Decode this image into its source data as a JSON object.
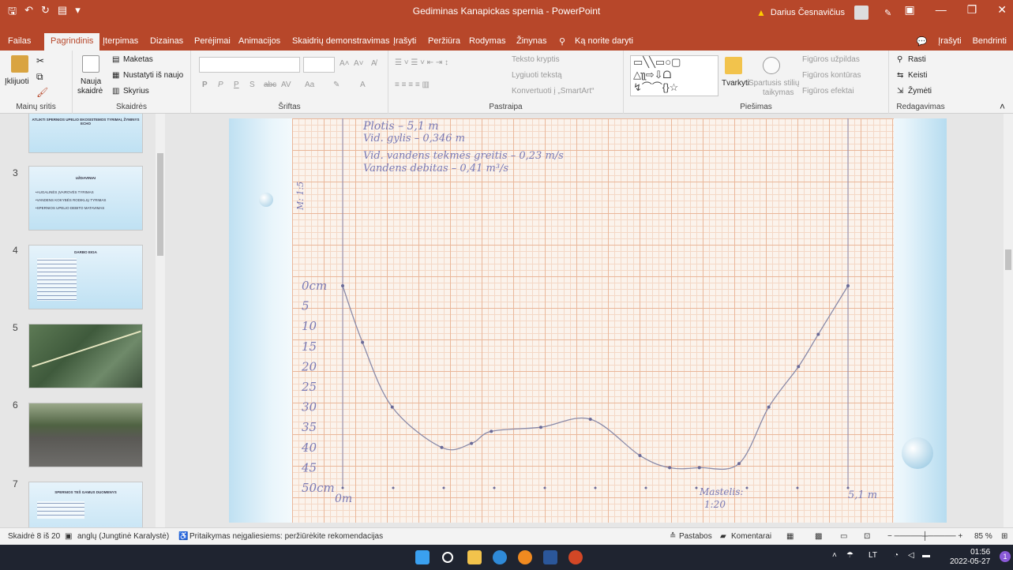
{
  "app": {
    "title": "Gediminas Kanapickas spernia  -  PowerPoint",
    "warning_icon": "warning-icon",
    "user_name": "Darius Česnavičius"
  },
  "tabs": [
    {
      "label": "Failas"
    },
    {
      "label": "Pagrindinis"
    },
    {
      "label": "Įterpimas"
    },
    {
      "label": "Dizainas"
    },
    {
      "label": "Perėjimai"
    },
    {
      "label": "Animacijos"
    },
    {
      "label": "Skaidrių demonstravimas"
    },
    {
      "label": "Įrašyti"
    },
    {
      "label": "Peržiūra"
    },
    {
      "label": "Rodymas"
    },
    {
      "label": "Žinynas"
    },
    {
      "label": "Ką norite daryti"
    }
  ],
  "tabs_right": {
    "record": "Įrašyti",
    "share": "Bendrinti"
  },
  "ribbon": {
    "clipboard": {
      "paste": "Įklijuoti",
      "group": "Mainų sritis"
    },
    "slides": {
      "new_slide_1": "Nauja",
      "new_slide_2": "skaidrė",
      "layout": "Maketas",
      "reset": "Nustatyti iš naujo",
      "section": "Skyrius",
      "group": "Skaidrės"
    },
    "font": {
      "group": "Šriftas",
      "bold": "P",
      "italic": "P",
      "underline": "P",
      "shadow": "S",
      "strike": "abc",
      "spacing": "AV",
      "case": "Aa",
      "color": "A"
    },
    "paragraph": {
      "text_direction": "Teksto kryptis",
      "align_text": "Lygiuoti tekstą",
      "smartart": "Konvertuoti į „SmartArt“",
      "group": "Pastraipa"
    },
    "drawing": {
      "arrange": "Tvarkyti",
      "quick_styles_1": "Spartusis stilių",
      "quick_styles_2": "taikymas",
      "fill": "Figūros užpildas",
      "outline": "Figūros kontūras",
      "effects": "Figūros efektai",
      "group": "Piešimas"
    },
    "editing": {
      "find": "Rasti",
      "replace": "Keisti",
      "select": "Žymėti",
      "group": "Redagavimas"
    }
  },
  "thumbnails": [
    {
      "num": "",
      "title": "ATLIKTI SPERNIOS UPELIO EKOSISTEMOS TYRIMAI, ŽYMINYS ECHO",
      "lines": []
    },
    {
      "num": "3",
      "title": "UŽDAVINIAI",
      "lines": [
        "•AUGALINĖS ĮVAIROVĖS TYRIMAS",
        "•VANDENS KOKYBĖS RODIKLIŲ TYRIMAS",
        "•SPERNIOS UPELIO DEBITO MATAVIMAS"
      ]
    },
    {
      "num": "4",
      "title": "DARBO EIGA",
      "lines": [
        "·",
        "·",
        "·",
        "·",
        "·",
        "·",
        "·",
        "·",
        "·",
        "·"
      ]
    },
    {
      "num": "5",
      "title": "",
      "lines": []
    },
    {
      "num": "6",
      "title": "",
      "lines": []
    },
    {
      "num": "7",
      "title": "SPERNIOS TEŠ GAMUS DUOMENYS",
      "lines": [
        "·",
        "·",
        "·",
        "·"
      ]
    }
  ],
  "slide": {
    "notes": [
      "Plotis – 5,1 m",
      "Vid. gylis – 0,346 m",
      "Vid. vandens tekmės greitis – 0,23 m/s",
      "Vandens debitas – 0,41 m³/s"
    ],
    "scale_vertical": "M: 1:5",
    "depth_labels": [
      "0cm",
      "5",
      "10",
      "15",
      "20",
      "25",
      "30",
      "35",
      "40",
      "45",
      "50cm"
    ],
    "bottom_left": "0m",
    "scale_bottom_1": "Mastelis:",
    "scale_bottom_2": "1:20",
    "bottom_right": "5,1 m"
  },
  "chart_data": {
    "type": "line",
    "xlabel": "",
    "ylabel": "",
    "x": [
      0.0,
      0.2,
      0.5,
      1.0,
      1.3,
      1.5,
      2.0,
      2.5,
      3.0,
      3.3,
      3.6,
      4.0,
      4.3,
      4.6,
      4.8,
      5.1
    ],
    "y": [
      0,
      14,
      30,
      40,
      39,
      36,
      35,
      33,
      42,
      45,
      45,
      44,
      30,
      20,
      12,
      0
    ],
    "ylim": [
      0,
      50
    ],
    "xlim": [
      0,
      5.1
    ],
    "y_inverted": true
  },
  "status": {
    "slide_count": "Skaidrė 8 iš 20",
    "language": "anglų (Jungtinė Karalystė)",
    "accessibility": "Pritaikymas neįgaliesiems: peržiūrėkite rekomendacijas",
    "notes": "Pastabos",
    "comments": "Komentarai",
    "zoom": "85 %"
  },
  "taskbar": {
    "lang": "LT",
    "time": "01:56",
    "date": "2022-05-27",
    "notif": "1"
  }
}
